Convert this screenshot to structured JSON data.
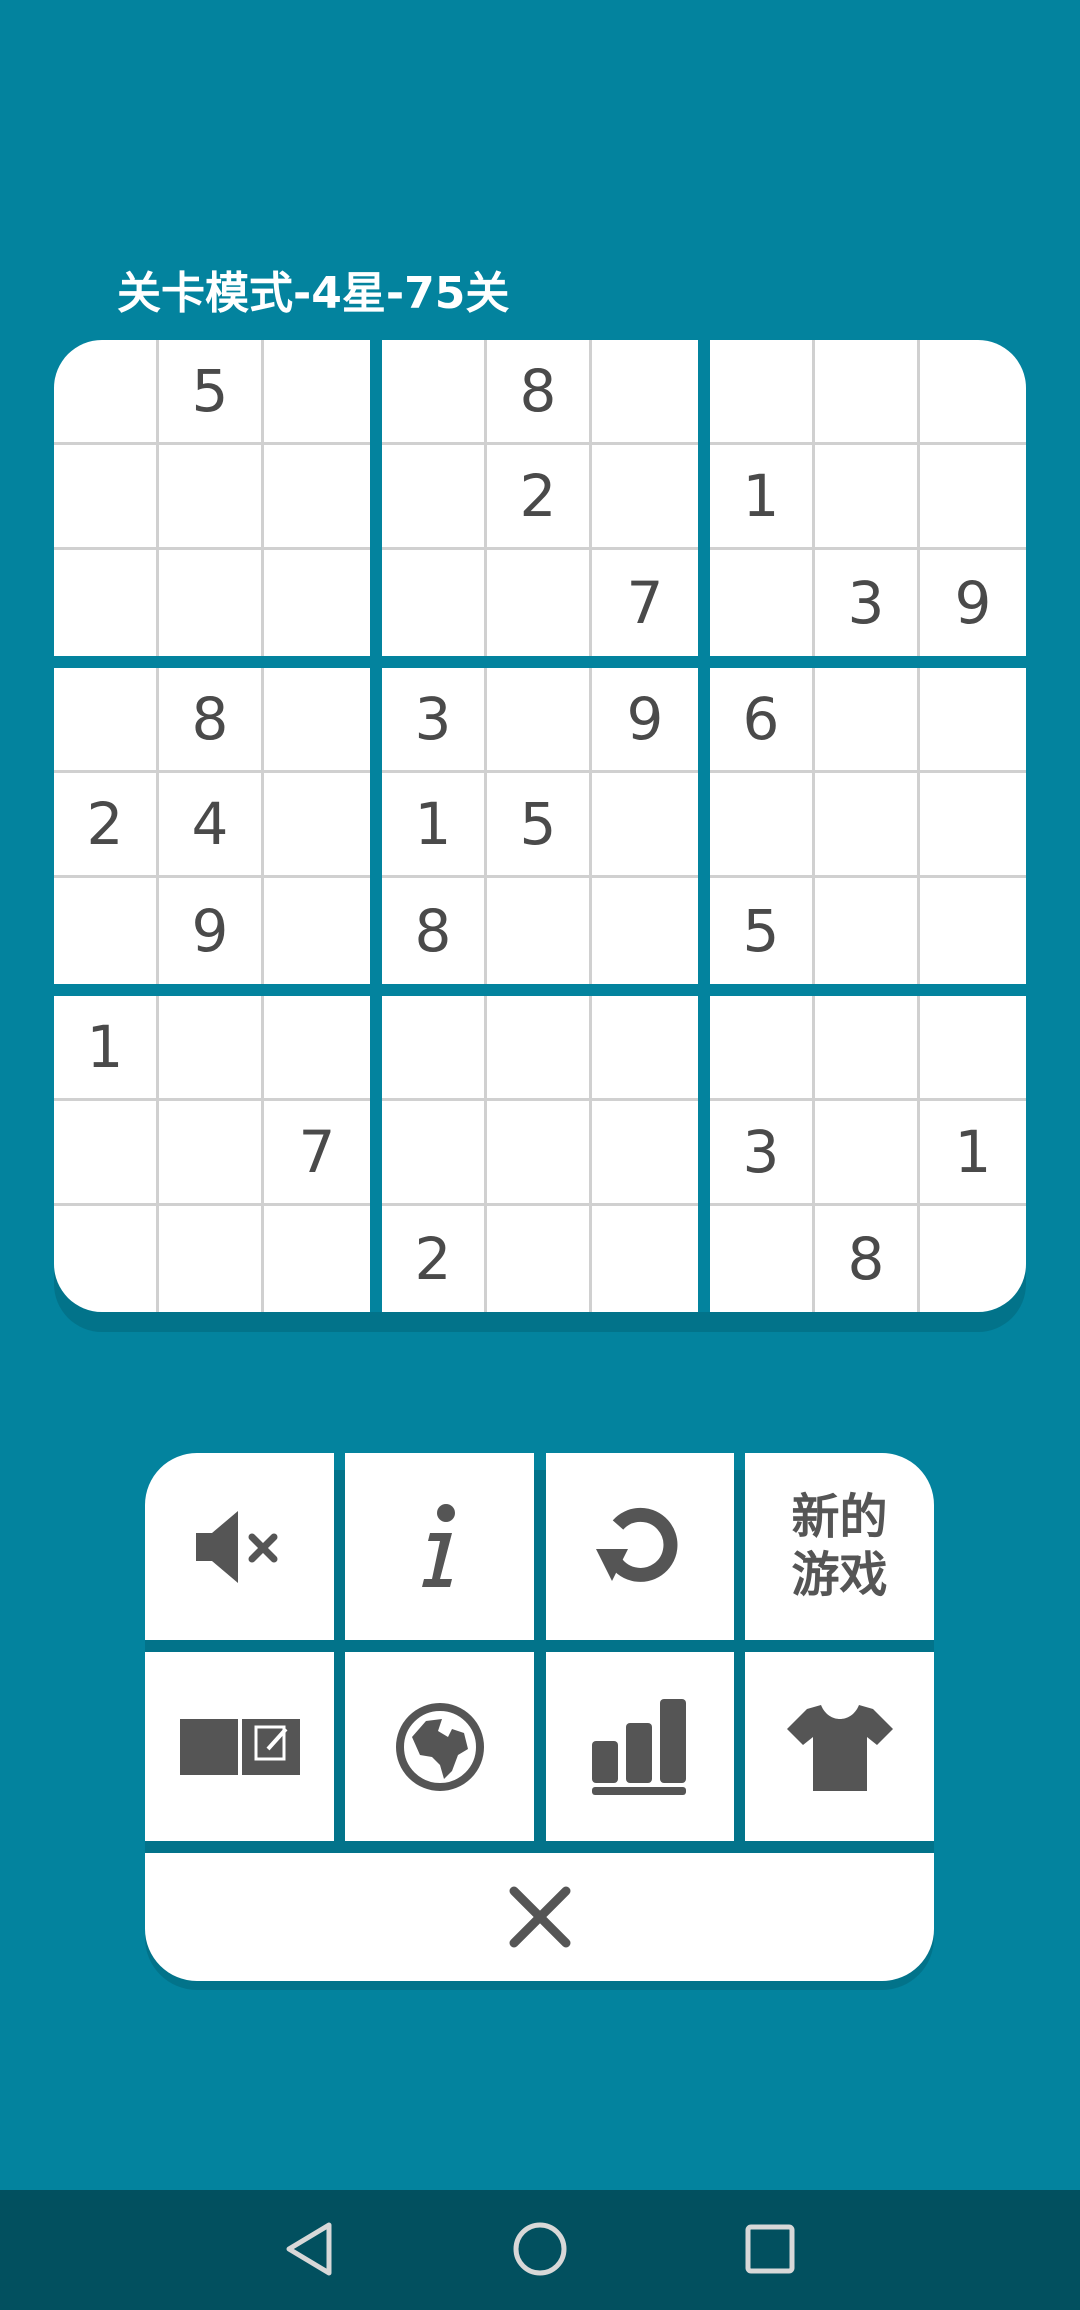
{
  "game": {
    "title": "关卡模式-4星-75关",
    "grid": [
      [
        "",
        "5",
        "",
        "",
        "8",
        "",
        "",
        "",
        ""
      ],
      [
        "",
        "",
        "",
        "",
        "2",
        "",
        "1",
        "",
        ""
      ],
      [
        "",
        "",
        "",
        "",
        "",
        "7",
        "",
        "3",
        "9"
      ],
      [
        "",
        "8",
        "",
        "3",
        "",
        "9",
        "6",
        "",
        ""
      ],
      [
        "2",
        "4",
        "",
        "1",
        "5",
        "",
        "",
        "",
        ""
      ],
      [
        "",
        "9",
        "",
        "8",
        "",
        "",
        "5",
        "",
        ""
      ],
      [
        "1",
        "",
        "",
        "",
        "",
        "",
        "",
        "",
        ""
      ],
      [
        "",
        "",
        "7",
        "",
        "",
        "",
        "3",
        "",
        "1"
      ],
      [
        "",
        "",
        "",
        "2",
        "",
        "",
        "",
        "8",
        ""
      ]
    ]
  },
  "menu": {
    "mute_icon": "speaker-muted-icon",
    "info_icon": "info-icon",
    "restart_icon": "restart-icon",
    "new_game_label": "新的游戏",
    "notes_icon": "notes-toggle-icon",
    "language_icon": "globe-icon",
    "stats_icon": "bar-chart-icon",
    "theme_icon": "tshirt-icon",
    "close_icon": "close-icon"
  },
  "colors": {
    "background": "#03839e",
    "cell": "#ffffff",
    "digit": "#4a4a4a",
    "icon": "#555555",
    "navbar": "#02505f"
  },
  "navbar": {
    "back_icon": "back-triangle-icon",
    "home_icon": "home-circle-icon",
    "recents_icon": "recents-square-icon"
  }
}
